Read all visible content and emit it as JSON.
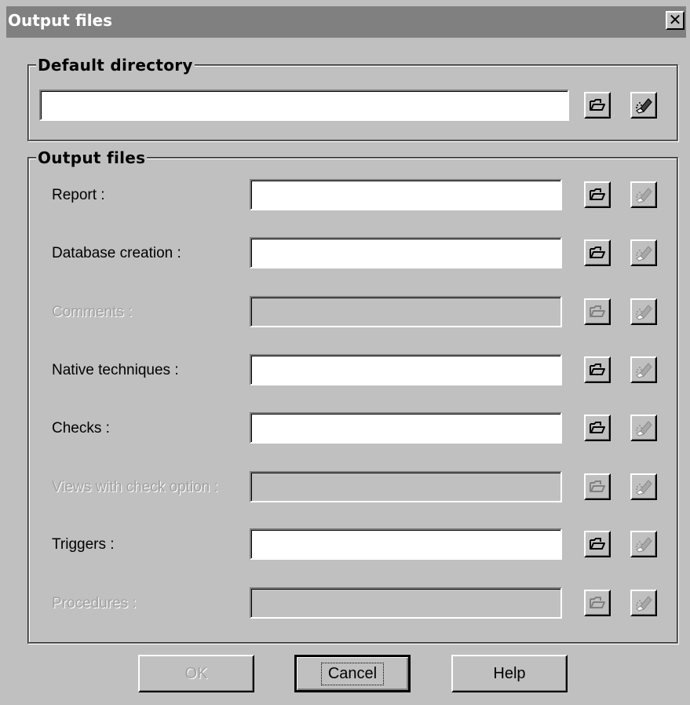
{
  "window": {
    "title": "Output files",
    "close_glyph": "✕"
  },
  "default_directory": {
    "group_title": "Default directory",
    "value": "",
    "browse_icon": "folder-open-icon",
    "clear_icon": "eraser-icon"
  },
  "output_files": {
    "group_title": "Output files",
    "rows": [
      {
        "label": "Report :",
        "value": "",
        "enabled": true
      },
      {
        "label": "Database creation :",
        "value": "",
        "enabled": true
      },
      {
        "label": "Comments :",
        "value": "",
        "enabled": false
      },
      {
        "label": "Native techniques :",
        "value": "",
        "enabled": true
      },
      {
        "label": "Checks :",
        "value": "",
        "enabled": true
      },
      {
        "label": "Views with check option :",
        "value": "",
        "enabled": false
      },
      {
        "label": "Triggers :",
        "value": "",
        "enabled": true
      },
      {
        "label": "Procedures :",
        "value": "",
        "enabled": false
      }
    ]
  },
  "buttons": {
    "ok": "OK",
    "cancel": "Cancel",
    "help": "Help"
  },
  "colors": {
    "face": "#c0c0c0",
    "title_bar": "#808080",
    "disabled_text": "#a0a0a0"
  }
}
